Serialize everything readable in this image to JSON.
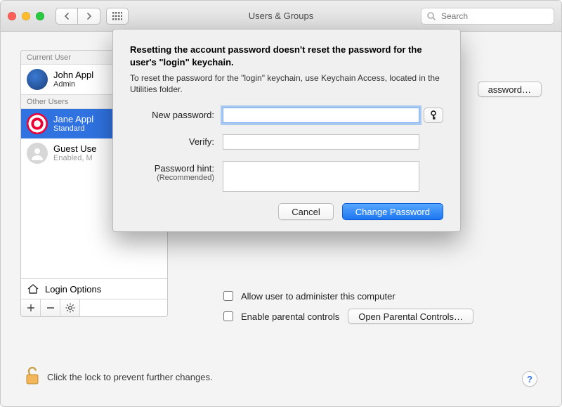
{
  "titlebar": {
    "title": "Users & Groups",
    "search_placeholder": "Search"
  },
  "sidebar": {
    "current_header": "Current User",
    "other_header": "Other Users",
    "login_options_label": "Login Options",
    "current": {
      "name": "John Appl",
      "role": "Admin"
    },
    "others": [
      {
        "name": "Jane Appl",
        "role": "Standard"
      },
      {
        "name": "Guest Use",
        "role": "Enabled, M"
      }
    ]
  },
  "right": {
    "change_password_btn": "assword…",
    "admin_checkbox": "Allow user to administer this computer",
    "parental_checkbox": "Enable parental controls",
    "open_parental_btn": "Open Parental Controls…"
  },
  "lock": {
    "text": "Click the lock to prevent further changes."
  },
  "dialog": {
    "heading": "Resetting the account password doesn't reset the password for the user's \"login\" keychain.",
    "subtext": "To reset the password for the \"login\" keychain, use Keychain Access, located in the Utilities folder.",
    "new_password_label": "New password:",
    "verify_label": "Verify:",
    "hint_label": "Password hint:",
    "hint_sub": "(Recommended)",
    "cancel": "Cancel",
    "confirm": "Change Password"
  }
}
